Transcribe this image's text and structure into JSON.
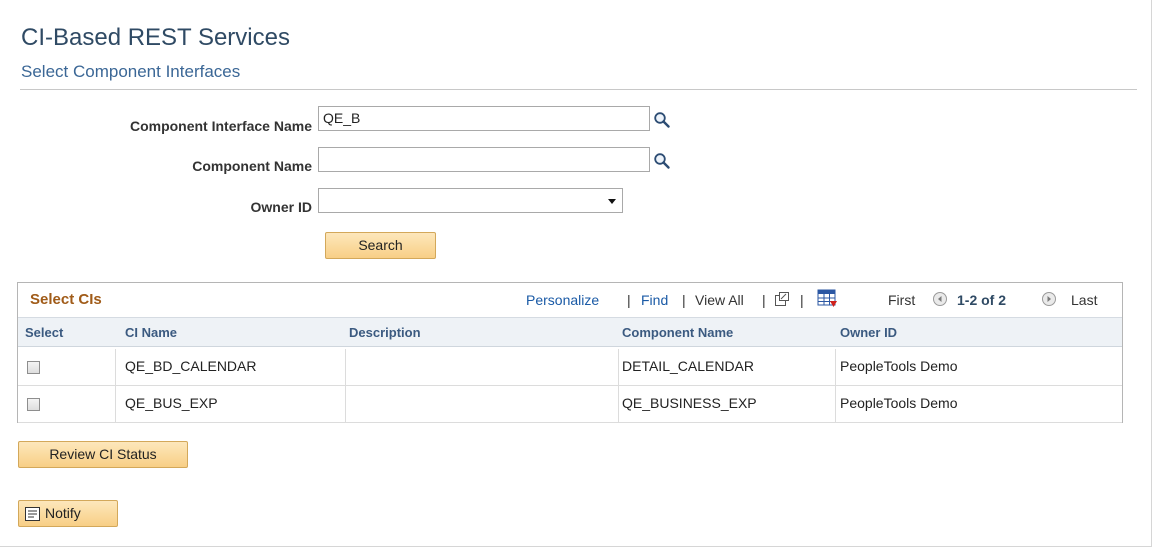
{
  "header": {
    "title": "CI-Based REST Services",
    "subtitle": "Select Component Interfaces"
  },
  "form": {
    "ci_name_label": "Component Interface Name",
    "ci_name_value": "QE_B",
    "component_name_label": "Component Name",
    "component_name_value": "",
    "owner_id_label": "Owner ID",
    "owner_id_value": "",
    "search_label": "Search"
  },
  "grid": {
    "title": "Select CIs",
    "nav": {
      "personalize": "Personalize",
      "find": "Find",
      "view_all": "View All",
      "sep": "|",
      "first": "First",
      "range": "1-2 of 2",
      "last": "Last"
    },
    "columns": [
      "Select",
      "CI Name",
      "Description",
      "Component Name",
      "Owner ID"
    ],
    "rows": [
      {
        "ci_name": "QE_BD_CALENDAR",
        "description": "",
        "component_name": "DETAIL_CALENDAR",
        "owner_id": "PeopleTools Demo"
      },
      {
        "ci_name": "QE_BUS_EXP",
        "description": "",
        "component_name": "QE_BUSINESS_EXP",
        "owner_id": "PeopleTools Demo"
      }
    ]
  },
  "actions": {
    "review_label": "Review CI Status",
    "notify_label": "Notify"
  },
  "icons": {
    "lookup": "magnifier-icon",
    "dropdown": "chevron-down-icon",
    "zoom": "new-window-icon",
    "download": "download-grid-icon",
    "first": "arrow-left-icon",
    "last": "arrow-right-icon",
    "notify": "notify-icon"
  },
  "colors": {
    "title": "#2f4a64",
    "link": "#1a5aa6",
    "grid_title": "#a05b18",
    "button": "#f8cf86"
  }
}
